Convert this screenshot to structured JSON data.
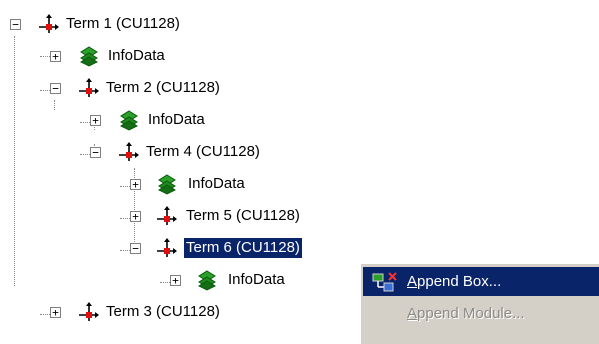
{
  "tree": {
    "nodes": [
      {
        "key": "term1",
        "label": "Term 1 (CU1128)",
        "icon": "terminal-icon",
        "expander": "minus",
        "selected": false
      },
      {
        "key": "infodata1",
        "label": "InfoData",
        "icon": "infodata-icon",
        "expander": "plus",
        "selected": false
      },
      {
        "key": "term2",
        "label": "Term 2 (CU1128)",
        "icon": "terminal-icon",
        "expander": "minus",
        "selected": false
      },
      {
        "key": "infodata2",
        "label": "InfoData",
        "icon": "infodata-icon",
        "expander": "plus",
        "selected": false
      },
      {
        "key": "term4",
        "label": "Term 4 (CU1128)",
        "icon": "terminal-icon",
        "expander": "minus",
        "selected": false
      },
      {
        "key": "infodata4",
        "label": "InfoData",
        "icon": "infodata-icon",
        "expander": "plus",
        "selected": false
      },
      {
        "key": "term5",
        "label": "Term 5 (CU1128)",
        "icon": "terminal-icon",
        "expander": "plus",
        "selected": false
      },
      {
        "key": "term6",
        "label": "Term 6 (CU1128)",
        "icon": "terminal-icon",
        "expander": "minus",
        "selected": true
      },
      {
        "key": "infodata6",
        "label": "InfoData",
        "icon": "infodata-icon",
        "expander": "plus",
        "selected": false
      },
      {
        "key": "term3",
        "label": "Term 3 (CU1128)",
        "icon": "terminal-icon",
        "expander": "plus",
        "selected": false
      }
    ]
  },
  "context_menu": {
    "items": [
      {
        "label_underlined": "A",
        "label_rest": "ppend Box...",
        "icon": "append-box-icon",
        "highlighted": true,
        "enabled": true
      },
      {
        "label_underlined": "A",
        "label_rest": "ppend Module...",
        "icon": "",
        "highlighted": false,
        "enabled": false
      }
    ]
  },
  "colors": {
    "selection": "#0a246a",
    "menu_background": "#d4d0c8",
    "disabled_text": "#8d8a84",
    "terminal_red": "#e01010",
    "infodata_green": "#2aa02a"
  }
}
